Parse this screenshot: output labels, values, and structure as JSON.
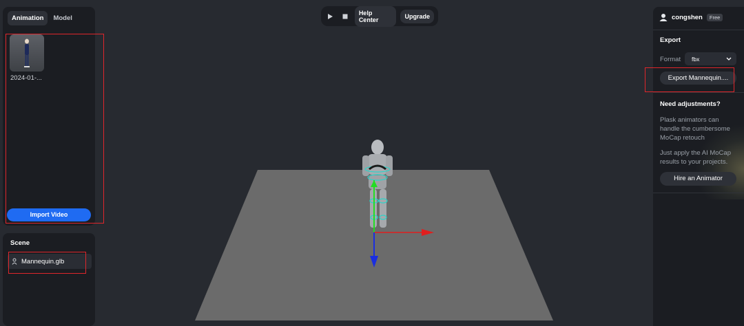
{
  "left_panel": {
    "tabs": [
      {
        "label": "Animation",
        "active": true
      },
      {
        "label": "Model",
        "active": false
      }
    ],
    "animation_item_label": "2024-01-...",
    "import_button_label": "Import Video"
  },
  "scene_panel": {
    "title": "Scene",
    "items": [
      {
        "label": "Mannequin.glb",
        "icon": "person-icon"
      }
    ]
  },
  "toolbar": {
    "play_icon": "play-icon",
    "stop_icon": "stop-icon",
    "help_label": "Help Center",
    "upgrade_label": "Upgrade"
  },
  "right_panel": {
    "user_name": "congshen",
    "plan_badge": "Free",
    "export_title": "Export",
    "format_label": "Format",
    "format_value": "fbx",
    "export_button_label": "Export Mannequin....",
    "adjust_title": "Need adjustments?",
    "adjust_text_1": "Plask animators can handle the cumbersome MoCap retouch",
    "adjust_text_2": "Just apply the AI MoCap results to your projects.",
    "hire_button_label": "Hire an Animator"
  },
  "colors": {
    "accent_blue": "#1f6bf2",
    "highlight_red": "#e0262b",
    "panel_bg": "#1b1d22",
    "viewport_bg": "#272a30",
    "floor": "#6b6b6b"
  }
}
